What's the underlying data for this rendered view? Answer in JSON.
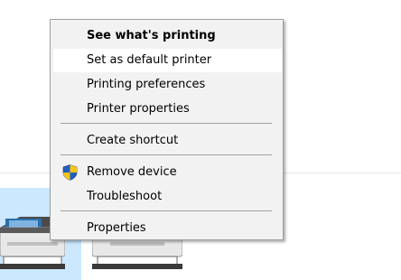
{
  "context_menu": {
    "items": [
      {
        "label": "See what's printing",
        "bold": true
      },
      {
        "label": "Set as default printer",
        "hover": true
      },
      {
        "label": "Printing preferences"
      },
      {
        "label": "Printer properties"
      },
      {
        "label": "Create shortcut"
      },
      {
        "label": "Remove device",
        "icon": "uac-shield-icon"
      },
      {
        "label": "Troubleshoot"
      },
      {
        "label": "Properties"
      }
    ]
  },
  "printers": [
    {
      "icon": "printer-icon",
      "selected": true
    },
    {
      "icon": "printer-icon",
      "selected": false
    }
  ],
  "colors": {
    "menu_bg": "#f2f2f2",
    "hover_bg": "#ffffff",
    "selection_bg": "#cce8ff",
    "separator": "#a0a0a0"
  }
}
